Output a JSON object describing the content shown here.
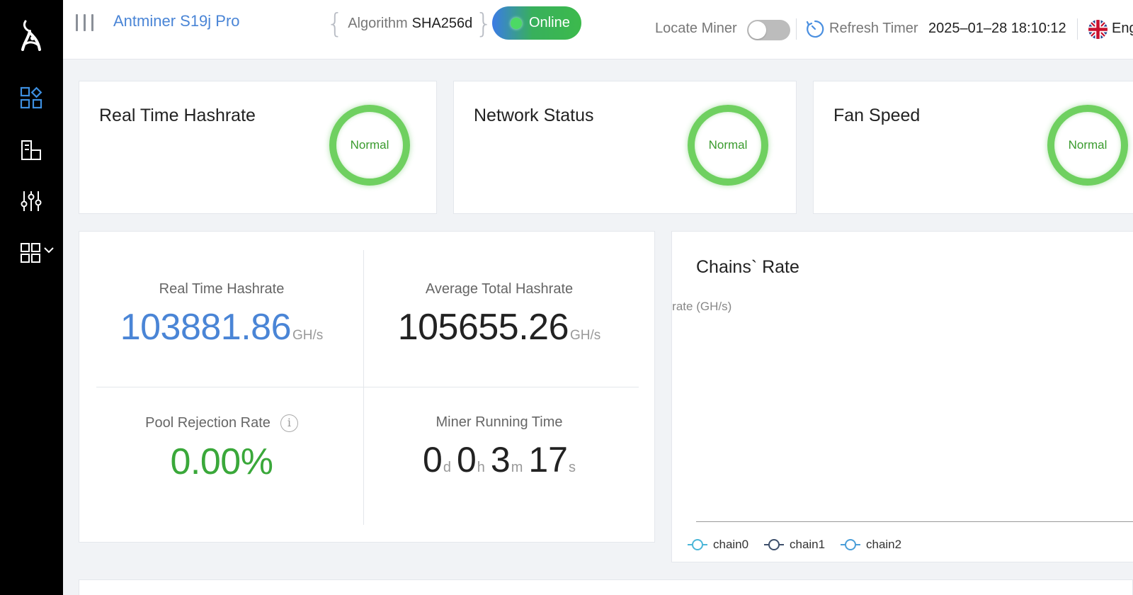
{
  "header": {
    "model_name": "Antminer S19j Pro",
    "algorithm_label": "Algorithm",
    "algorithm_value": "SHA256d",
    "status": "Online",
    "locate_label": "Locate Miner",
    "locate_enabled": false,
    "refresh_label": "Refresh Timer",
    "refresh_value": "2025–01–28 18:10:12",
    "language": "English"
  },
  "sidebar": {
    "items": [
      {
        "icon": "dashboard-icon",
        "active": true
      },
      {
        "icon": "miner-status-icon",
        "active": false
      },
      {
        "icon": "settings-sliders-icon",
        "active": false
      },
      {
        "icon": "system-grid-icon",
        "active": false,
        "expandable": true
      }
    ]
  },
  "status_cards": [
    {
      "title": "Real Time Hashrate",
      "state": "Normal"
    },
    {
      "title": "Network Status",
      "state": "Normal"
    },
    {
      "title": "Fan Speed",
      "state": "Normal"
    }
  ],
  "stats": {
    "realtime_label": "Real Time Hashrate",
    "realtime_value": "103881.86",
    "realtime_unit": "GH/s",
    "average_label": "Average Total Hashrate",
    "average_value": "105655.26",
    "average_unit": "GH/s",
    "rejection_label": "Pool Rejection Rate",
    "rejection_info": "i",
    "rejection_value": "0.00%",
    "runtime_label": "Miner Running Time",
    "runtime": {
      "days": "0",
      "days_unit": "d",
      "hours": "0",
      "hours_unit": "h",
      "minutes": "3",
      "minutes_unit": "m",
      "seconds": "17",
      "seconds_unit": "s"
    }
  },
  "chart": {
    "title": "Chains` Rate",
    "ylabel": "n rate (GH/s)",
    "legend": [
      {
        "name": "chain0",
        "color": "#4ab6d8"
      },
      {
        "name": "chain1",
        "color": "#3d4f6b"
      },
      {
        "name": "chain2",
        "color": "#4a9ed8"
      }
    ]
  },
  "colors": {
    "accent_blue": "#4a85d6",
    "ok_green": "#3aa83a",
    "ring_green": "#6fd060"
  }
}
